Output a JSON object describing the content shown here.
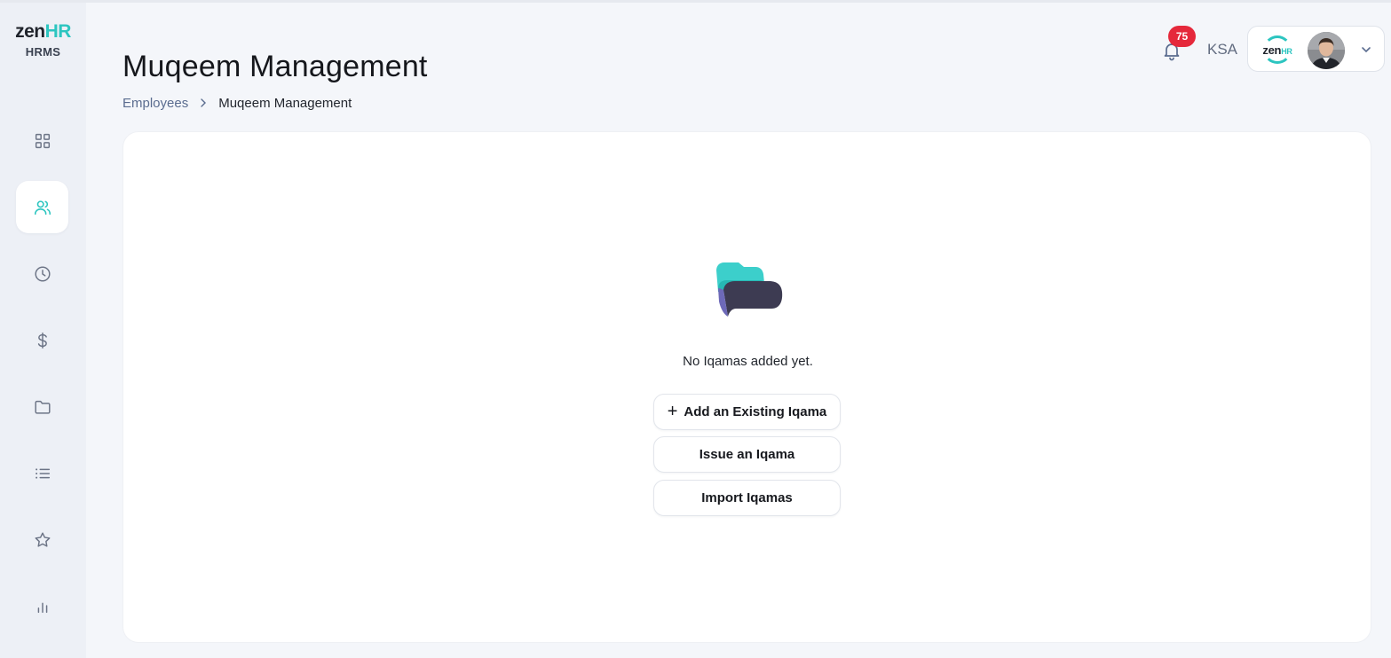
{
  "app": {
    "logo_primary": "zen",
    "logo_accent": "HR",
    "logo_subtitle": "HRMS"
  },
  "sidebar": {
    "items": [
      {
        "icon": "dashboard-grid-icon",
        "active": false
      },
      {
        "icon": "employees-icon",
        "active": true
      },
      {
        "icon": "clock-icon",
        "active": false
      },
      {
        "icon": "dollar-icon",
        "active": false
      },
      {
        "icon": "folder-icon",
        "active": false
      },
      {
        "icon": "list-icon",
        "active": false
      },
      {
        "icon": "star-icon",
        "active": false
      },
      {
        "icon": "bar-chart-icon",
        "active": false
      }
    ]
  },
  "header": {
    "title": "Muqeem Management",
    "breadcrumb": {
      "parent": "Employees",
      "current": "Muqeem Management"
    },
    "notifications_count": "75",
    "region": "KSA",
    "company_logo_primary": "zen",
    "company_logo_accent": "HR"
  },
  "empty_state": {
    "message": "No Iqamas added yet.",
    "buttons": {
      "add_existing": "Add an Existing Iqama",
      "issue": "Issue an Iqama",
      "import": "Import Iqamas"
    }
  },
  "colors": {
    "accent": "#2cc5c0",
    "badge": "#e5283b",
    "sidebar_bg": "#edf0f6",
    "page_bg": "#f4f6fa"
  }
}
